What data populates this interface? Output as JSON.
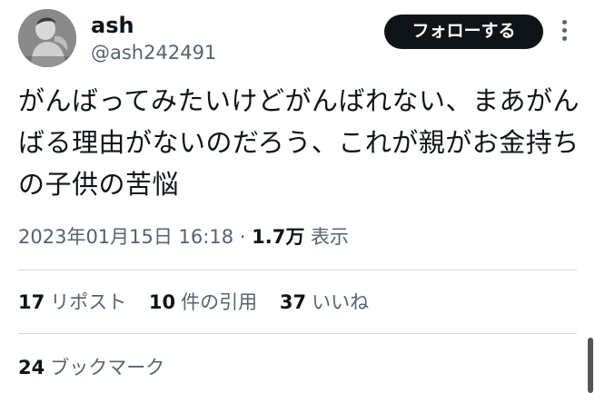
{
  "user": {
    "name": "ash",
    "handle": "@ash242491"
  },
  "header": {
    "follow_label": "フォローする",
    "more_icon": "more-vertical-icon"
  },
  "tweet": {
    "text": "がんばってみたいけどがんばれない、まあがんばる理由がないのだろう、これが親がお金持ちの子供の苦悩"
  },
  "meta": {
    "timestamp": "2023年01月15日 16:18",
    "separator": "·",
    "views": "1.7万",
    "views_label": "表示"
  },
  "stats": {
    "reposts": {
      "count": "17",
      "label": "リポスト"
    },
    "quotes": {
      "count": "10",
      "label": "件の引用"
    },
    "likes": {
      "count": "37",
      "label": "いいね"
    }
  },
  "bookmarks": {
    "count": "24",
    "label": "ブックマーク"
  },
  "colors": {
    "text_primary": "#0f1419",
    "text_secondary": "#536471",
    "divider": "#cfd9de",
    "button_bg": "#0f1419"
  }
}
